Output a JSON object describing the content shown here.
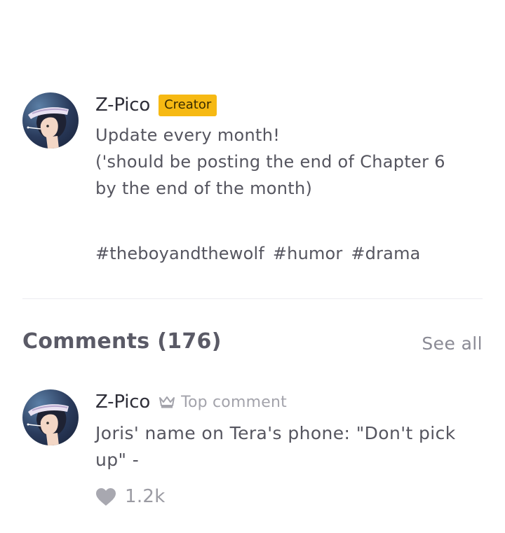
{
  "author": {
    "name": "Z-Pico",
    "badge": "Creator",
    "description_lines": [
      "Update every month!",
      "('should be posting the end of Chapter 6",
      "by the end of the month)"
    ],
    "tags": [
      "#theboyandthewolf",
      "#humor",
      "#drama"
    ]
  },
  "comments": {
    "title": "Comments (176)",
    "see_all": "See all",
    "items": [
      {
        "author": "Z-Pico",
        "label": "Top comment",
        "text_lines": [
          "Joris' name on Tera's phone: \"Don't pick",
          "up\" -"
        ],
        "likes": "1.2k"
      }
    ]
  },
  "colors": {
    "badge": "#f6b913",
    "text": "#55555f",
    "muted": "#9b9ba3",
    "avatar_bg": "#2a3b5c"
  },
  "icons": {
    "top_comment": "crown-icon",
    "like": "heart-icon"
  }
}
